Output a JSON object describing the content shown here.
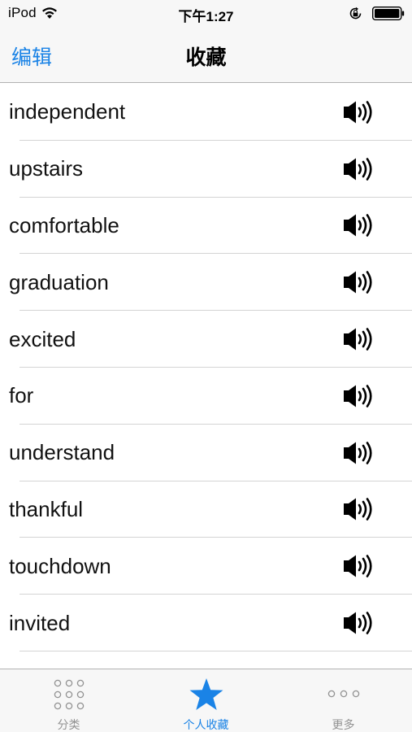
{
  "status_bar": {
    "carrier": "iPod",
    "time": "下午1:27"
  },
  "nav": {
    "edit_label": "编辑",
    "title": "收藏"
  },
  "words": [
    "independent",
    "upstairs",
    "comfortable",
    "graduation",
    "excited",
    "for",
    "understand",
    "thankful",
    "touchdown",
    "invited"
  ],
  "tabs": [
    {
      "label": "分类",
      "icon": "grid-dots-icon",
      "active": false
    },
    {
      "label": "个人收藏",
      "icon": "star-icon",
      "active": true
    },
    {
      "label": "更多",
      "icon": "more-dots-icon",
      "active": false
    }
  ],
  "colors": {
    "accent": "#1a83e6",
    "inactive": "#929292",
    "bar_bg": "#f7f7f7"
  }
}
